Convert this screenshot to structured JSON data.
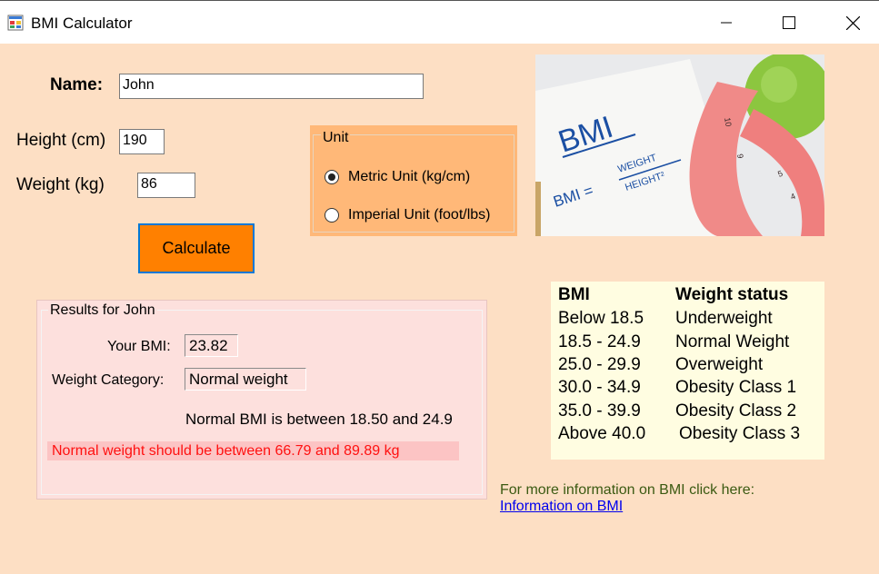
{
  "window": {
    "title": "BMI Calculator"
  },
  "form": {
    "name_label": "Name:",
    "name_value": "John",
    "height_label": "Height (cm)",
    "height_value": "190",
    "weight_label": "Weight (kg)",
    "weight_value": "86",
    "calculate_label": "Calculate"
  },
  "unit_group": {
    "title": "Unit",
    "options": [
      {
        "label": "Metric Unit (kg/cm)",
        "checked": true
      },
      {
        "label": "Imperial Unit (foot/lbs)",
        "checked": false
      }
    ]
  },
  "results": {
    "title": "Results for John",
    "bmi_label": "Your BMI:",
    "bmi_value": "23.82",
    "category_label": "Weight Category:",
    "category_value": "Normal weight",
    "normal_range": "Normal BMI is between 18.50 and 24.9",
    "weight_range": "Normal weight should be between 66.79 and 89.89 kg"
  },
  "bmi_table": {
    "headers": [
      "BMI",
      "Weight status"
    ],
    "rows": [
      [
        "Below 18.5",
        "Underweight"
      ],
      [
        "18.5 - 24.9",
        "Normal Weight"
      ],
      [
        "25.0 - 29.9",
        "Overweight"
      ],
      [
        "30.0 - 34.9",
        "Obesity Class 1"
      ],
      [
        "35.0 - 39.9",
        "Obesity Class 2"
      ],
      [
        "Above 40.0",
        "Obesity Class 3"
      ]
    ]
  },
  "info": {
    "text": "For more information on BMI click here:",
    "link": "Information on BMI"
  },
  "image": {
    "bmi_text": "BMI",
    "formula_left": "BMI =",
    "formula_top": "WEIGHT",
    "formula_bottom": "HEIGHT²"
  },
  "colors": {
    "background": "#fddfc4",
    "button": "#ff8000",
    "unit_group": "#ffb878",
    "results_bg": "#fde0dd",
    "warning_bg": "#fcc4c4",
    "warning_text": "#ff1010",
    "table_bg": "#fffde1",
    "info_text": "#3b5a12",
    "link": "#0000ee"
  }
}
